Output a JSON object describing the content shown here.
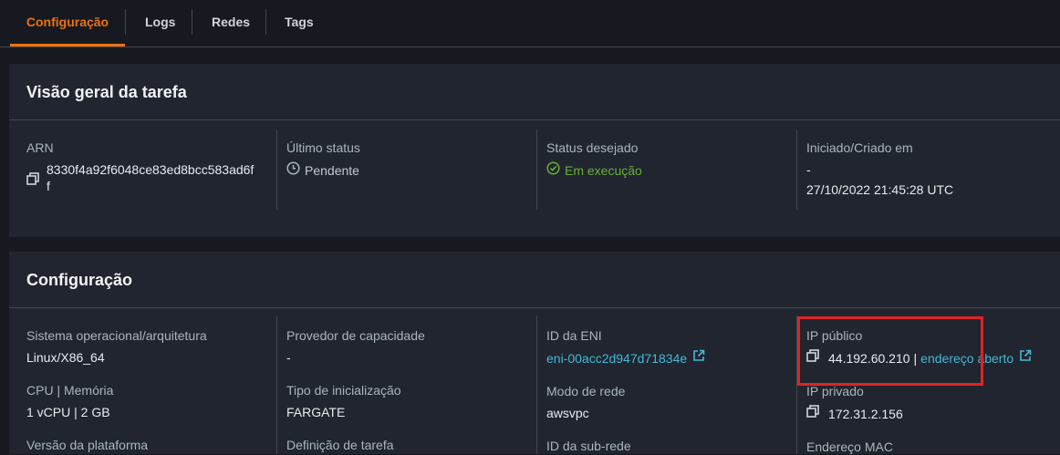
{
  "tabs": [
    "Configuração",
    "Logs",
    "Redes",
    "Tags"
  ],
  "overview": {
    "title": "Visão geral da tarefa",
    "arn_label": "ARN",
    "arn_value_line1": "8330f4a92f6048ce83ed8bcc583ad6f",
    "arn_value_line2": "f",
    "last_status_label": "Último status",
    "last_status_value": "Pendente",
    "desired_status_label": "Status desejado",
    "desired_status_value": "Em execução",
    "started_label": "Iniciado/Criado em",
    "started_value_line1": "-",
    "started_value_line2": "27/10/2022 21:45:28 UTC"
  },
  "config": {
    "title": "Configuração",
    "os_label": "Sistema operacional/arquitetura",
    "os_value": "Linux/X86_64",
    "cpu_label": "CPU | Memória",
    "cpu_value": "1 vCPU | 2 GB",
    "platform_label": "Versão da plataforma",
    "capacity_label": "Provedor de capacidade",
    "capacity_value": "-",
    "launch_label": "Tipo de inicialização",
    "launch_value": "FARGATE",
    "taskdef_label": "Definição de tarefa",
    "eni_label": "ID da ENI",
    "eni_value": "eni-00acc2d947d71834e",
    "network_mode_label": "Modo de rede",
    "network_mode_value": "awsvpc",
    "subnet_label": "ID da sub-rede",
    "public_ip_label": "IP público",
    "public_ip_value": "44.192.60.210",
    "public_ip_sep": "|",
    "open_address": "endereço aberto",
    "private_ip_label": "IP privado",
    "private_ip_value": "172.31.2.156",
    "mac_label": "Endereço MAC"
  },
  "colors": {
    "accent": "#ec7211",
    "link": "#44b9d6",
    "success": "#6aaf35",
    "highlight": "#e52222"
  }
}
